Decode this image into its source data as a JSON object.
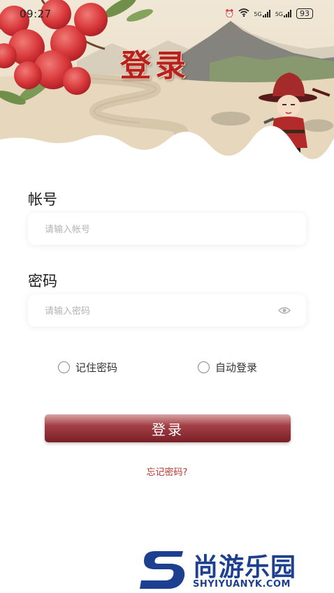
{
  "status_bar": {
    "time": "09:27",
    "network_1": "5G",
    "network_2": "5G",
    "battery": "93"
  },
  "header": {
    "title": "登录"
  },
  "form": {
    "account_label": "帐号",
    "account_placeholder": "请输入帐号",
    "password_label": "密码",
    "password_placeholder": "请输入密码",
    "remember_password": "记住密码",
    "auto_login": "自动登录",
    "login_button": "登录",
    "forgot_password": "忘记密码?"
  },
  "watermark": {
    "cn": "尚游乐园",
    "en": "SHYIYUANYK.COM"
  },
  "colors": {
    "accent": "#b8211f",
    "button": "#7a1f26",
    "watermark": "#1d3f8f"
  }
}
